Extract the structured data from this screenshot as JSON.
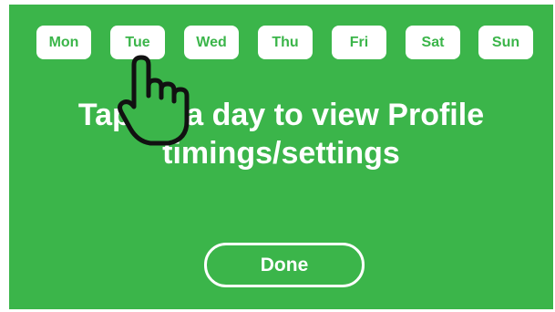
{
  "colors": {
    "background": "#3bb54a",
    "pill": "#ffffff",
    "pill_text": "#3bb54a",
    "text": "#ffffff"
  },
  "days": [
    {
      "label": "Mon"
    },
    {
      "label": "Tue"
    },
    {
      "label": "Wed"
    },
    {
      "label": "Thu"
    },
    {
      "label": "Fri"
    },
    {
      "label": "Sat"
    },
    {
      "label": "Sun"
    }
  ],
  "hint": {
    "line1": "Tap on a day to view Profile",
    "line2": "timings/settings"
  },
  "done_label": "Done",
  "pointer_icon": "hand-pointer-icon"
}
